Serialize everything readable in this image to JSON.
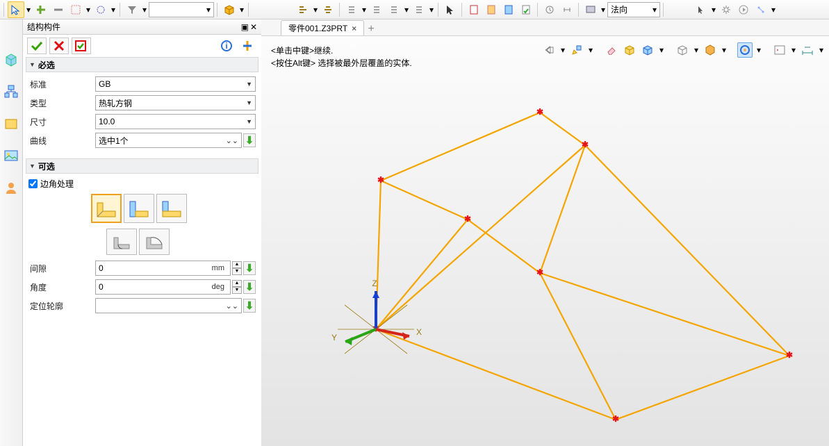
{
  "toolbar": {
    "combo1": "",
    "combo_view": "法向"
  },
  "panel": {
    "title": "结构构件",
    "section_required": "必选",
    "section_optional": "可选",
    "labels": {
      "standard": "标准",
      "type": "类型",
      "size": "尺寸",
      "curve": "曲线",
      "corner": "边角处理",
      "gap": "间隙",
      "angle": "角度",
      "profile": "定位轮廓"
    },
    "values": {
      "standard": "GB",
      "type": "热轧方钢",
      "size": "10.0",
      "curve": "选中1个",
      "gap": "0",
      "gap_unit": "mm",
      "angle": "0",
      "angle_unit": "deg",
      "profile": ""
    }
  },
  "tab": {
    "name": "零件001.Z3PRT"
  },
  "hints": {
    "line1": "<单击中键>继续.",
    "line2": "<按住Alt键> 选择被最外层覆盖的实体."
  },
  "axes": {
    "x": "X",
    "y": "Y",
    "z": "Z"
  }
}
